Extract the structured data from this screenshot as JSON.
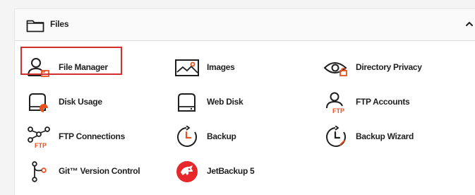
{
  "panel": {
    "title": "Files",
    "header_icon": "folder-icon",
    "toggle_icon": "chevron-up-icon"
  },
  "items": [
    {
      "label": "File Manager",
      "icon": "file-manager-icon",
      "highlighted": true
    },
    {
      "label": "Images",
      "icon": "images-icon"
    },
    {
      "label": "Directory Privacy",
      "icon": "eye-lock-icon"
    },
    {
      "label": "Disk Usage",
      "icon": "disk-usage-icon"
    },
    {
      "label": "Web Disk",
      "icon": "web-disk-icon"
    },
    {
      "label": "FTP Accounts",
      "icon": "ftp-user-icon"
    },
    {
      "label": "FTP Connections",
      "icon": "ftp-network-icon"
    },
    {
      "label": "Backup",
      "icon": "backup-clock-icon"
    },
    {
      "label": "Backup Wizard",
      "icon": "backup-wizard-icon"
    },
    {
      "label": "Git™ Version Control",
      "icon": "git-icon"
    },
    {
      "label": "JetBackup 5",
      "icon": "jetbackup-icon"
    }
  ],
  "icon_badge_text": "FTP",
  "colors": {
    "accent": "#e8501d",
    "highlight": "#d32f2f",
    "icon_stroke": "#1f1f1f",
    "jetbackup": "#e8272c"
  }
}
